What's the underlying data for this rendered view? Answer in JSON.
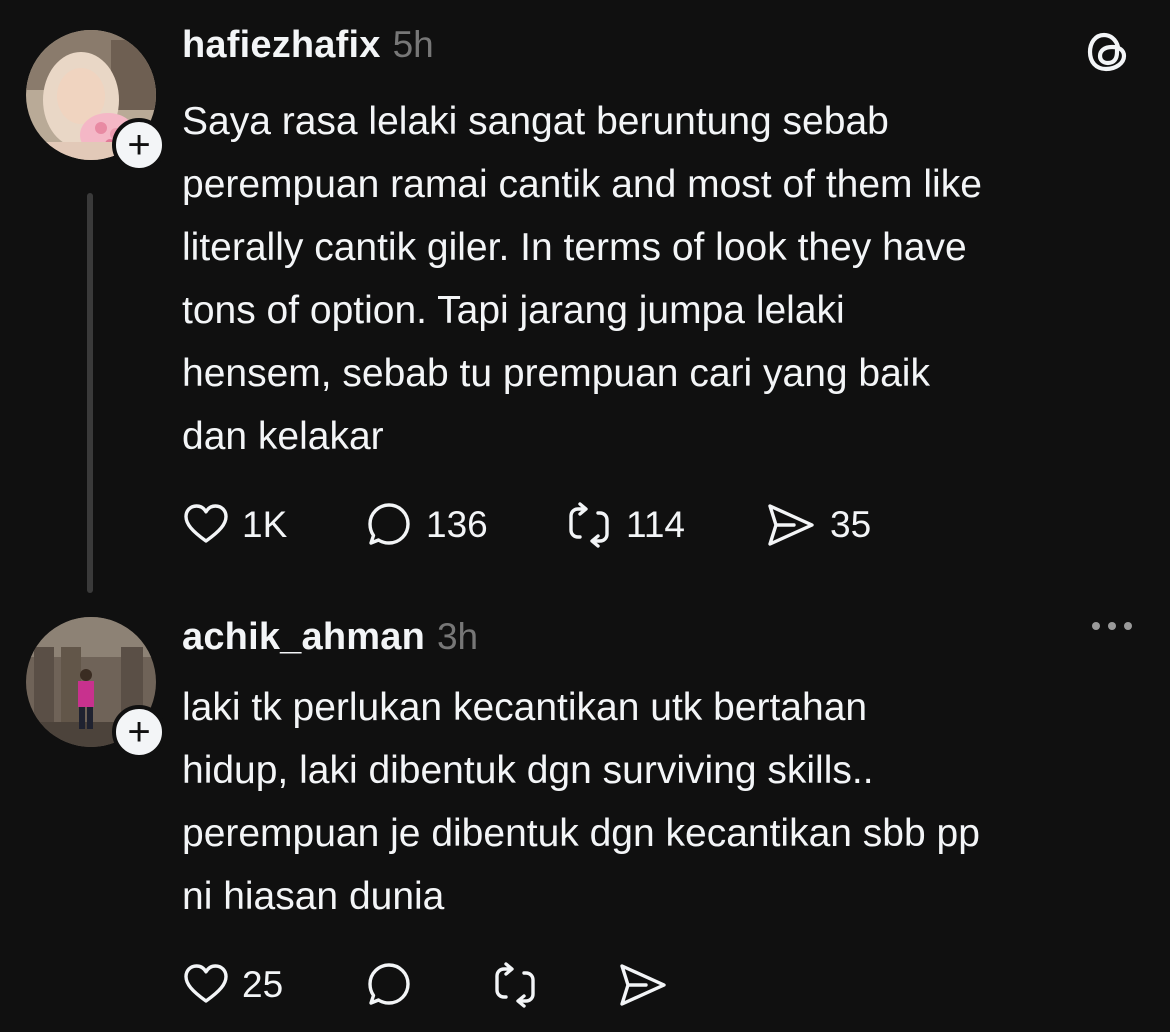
{
  "posts": [
    {
      "username": "hafiezhafix",
      "time": "5h",
      "body": "Saya rasa lelaki sangat beruntung sebab\nperempuan ramai cantik and most of them like\nliterally cantik giler. In terms of look they have\ntons of option. Tapi jarang jumpa lelaki\nhensem, sebab tu prempuan cari yang baik\ndan kelakar",
      "likes": "1K",
      "replies": "136",
      "reposts": "114",
      "shares": "35"
    },
    {
      "username": "achik_ahman",
      "time": "3h",
      "body": "laki tk perlukan kecantikan utk bertahan\nhidup, laki dibentuk dgn surviving skills..\nperempuan je dibentuk dgn kecantikan sbb pp\nni hiasan dunia",
      "likes": "25"
    }
  ],
  "icons": {
    "follow": "plus-icon",
    "like": "heart-icon",
    "reply": "speech-bubble-icon",
    "repost": "repost-icon",
    "share": "send-icon",
    "brand": "threads-logo-icon",
    "menu": "more-icon"
  },
  "colors": {
    "background": "#101010",
    "text": "#f3f5f7",
    "muted": "#777777",
    "thread_line": "#3a3a3a"
  }
}
